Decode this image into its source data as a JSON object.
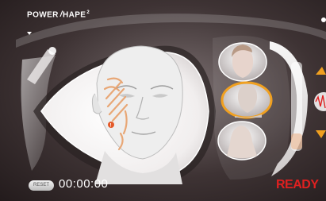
{
  "header": {
    "brand_logo": "POWERSHAPE2",
    "brand_text": "POWER",
    "brand_text2": "HAPE",
    "brand_sup": "2",
    "menu_caret_icon": "caret-down-icon"
  },
  "footer": {
    "reset_label": "RESET",
    "timer": "00:00:00",
    "status": "READY"
  },
  "side_controls": {
    "up_icon": "arrow-up-icon",
    "wave_icon": "waveform-icon",
    "down_icon": "arrow-down-icon"
  },
  "zones": [
    "face-zone",
    "neck-zone",
    "decollete-zone"
  ],
  "selected_zone": "face-zone",
  "colors": {
    "accent": "#f0a020",
    "status": "#e02020",
    "treatment_lines": "#e8a06a"
  },
  "marker": "!"
}
